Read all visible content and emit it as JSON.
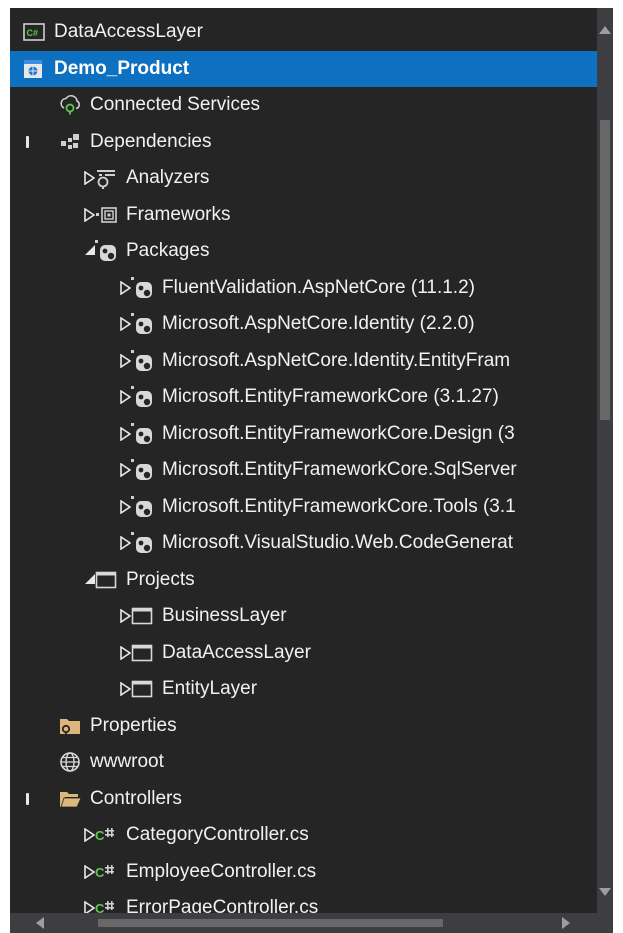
{
  "tree": [
    {
      "label": "DataAccessLayer",
      "icon": "csharp-project-icon",
      "arrow": "none",
      "depth": 0,
      "marker": false,
      "selected": false
    },
    {
      "label": "Demo_Product",
      "icon": "web-project-icon",
      "arrow": "none",
      "depth": 0,
      "marker": false,
      "selected": true
    },
    {
      "label": "Connected Services",
      "icon": "connected-services-icon",
      "arrow": "none",
      "depth": 1,
      "marker": false,
      "selected": false
    },
    {
      "label": "Dependencies",
      "icon": "dependencies-icon",
      "arrow": "none",
      "depth": 1,
      "marker": true,
      "selected": false
    },
    {
      "label": "Analyzers",
      "icon": "analyzer-icon",
      "arrow": "collapsed",
      "depth": 2,
      "marker": false,
      "selected": false
    },
    {
      "label": "Frameworks",
      "icon": "framework-icon",
      "arrow": "collapsed",
      "depth": 2,
      "marker": false,
      "selected": false
    },
    {
      "label": "Packages",
      "icon": "package-icon",
      "arrow": "expanded",
      "depth": 2,
      "marker": false,
      "selected": false
    },
    {
      "label": "FluentValidation.AspNetCore (11.1.2)",
      "icon": "package-icon",
      "arrow": "collapsed",
      "depth": 3,
      "marker": false,
      "selected": false
    },
    {
      "label": "Microsoft.AspNetCore.Identity (2.2.0)",
      "icon": "package-icon",
      "arrow": "collapsed",
      "depth": 3,
      "marker": false,
      "selected": false
    },
    {
      "label": "Microsoft.AspNetCore.Identity.EntityFram",
      "icon": "package-icon",
      "arrow": "collapsed",
      "depth": 3,
      "marker": false,
      "selected": false
    },
    {
      "label": "Microsoft.EntityFrameworkCore (3.1.27)",
      "icon": "package-icon",
      "arrow": "collapsed",
      "depth": 3,
      "marker": false,
      "selected": false
    },
    {
      "label": "Microsoft.EntityFrameworkCore.Design (3",
      "icon": "package-icon",
      "arrow": "collapsed",
      "depth": 3,
      "marker": false,
      "selected": false
    },
    {
      "label": "Microsoft.EntityFrameworkCore.SqlServer",
      "icon": "package-icon",
      "arrow": "collapsed",
      "depth": 3,
      "marker": false,
      "selected": false
    },
    {
      "label": "Microsoft.EntityFrameworkCore.Tools (3.1",
      "icon": "package-icon",
      "arrow": "collapsed",
      "depth": 3,
      "marker": false,
      "selected": false
    },
    {
      "label": "Microsoft.VisualStudio.Web.CodeGenerat",
      "icon": "package-icon",
      "arrow": "collapsed",
      "depth": 3,
      "marker": false,
      "selected": false
    },
    {
      "label": "Projects",
      "icon": "project-reference-icon",
      "arrow": "expanded",
      "depth": 2,
      "marker": false,
      "selected": false
    },
    {
      "label": "BusinessLayer",
      "icon": "project-reference-icon",
      "arrow": "collapsed",
      "depth": 3,
      "marker": false,
      "selected": false
    },
    {
      "label": "DataAccessLayer",
      "icon": "project-reference-icon",
      "arrow": "collapsed",
      "depth": 3,
      "marker": false,
      "selected": false
    },
    {
      "label": "EntityLayer",
      "icon": "project-reference-icon",
      "arrow": "collapsed",
      "depth": 3,
      "marker": false,
      "selected": false
    },
    {
      "label": "Properties",
      "icon": "properties-folder-icon",
      "arrow": "none",
      "depth": 1,
      "marker": false,
      "selected": false
    },
    {
      "label": "wwwroot",
      "icon": "globe-icon",
      "arrow": "none",
      "depth": 1,
      "marker": false,
      "selected": false
    },
    {
      "label": "Controllers",
      "icon": "folder-open-icon",
      "arrow": "none",
      "depth": 1,
      "marker": true,
      "selected": false
    },
    {
      "label": "CategoryController.cs",
      "icon": "csharp-file-icon",
      "arrow": "collapsed",
      "depth": 2,
      "marker": false,
      "selected": false
    },
    {
      "label": "EmployeeController.cs",
      "icon": "csharp-file-icon",
      "arrow": "collapsed",
      "depth": 2,
      "marker": false,
      "selected": false
    },
    {
      "label": "ErrorPageController.cs",
      "icon": "csharp-file-icon",
      "arrow": "collapsed",
      "depth": 2,
      "marker": false,
      "selected": false
    }
  ],
  "colors": {
    "background": "#252526",
    "selection": "#0e70c0",
    "text": "#f1f1f1",
    "csharp": "#5fc84a",
    "folder": "#dcb67a",
    "scrollbar_track": "#3e3e42",
    "scrollbar_thumb": "#686868"
  }
}
